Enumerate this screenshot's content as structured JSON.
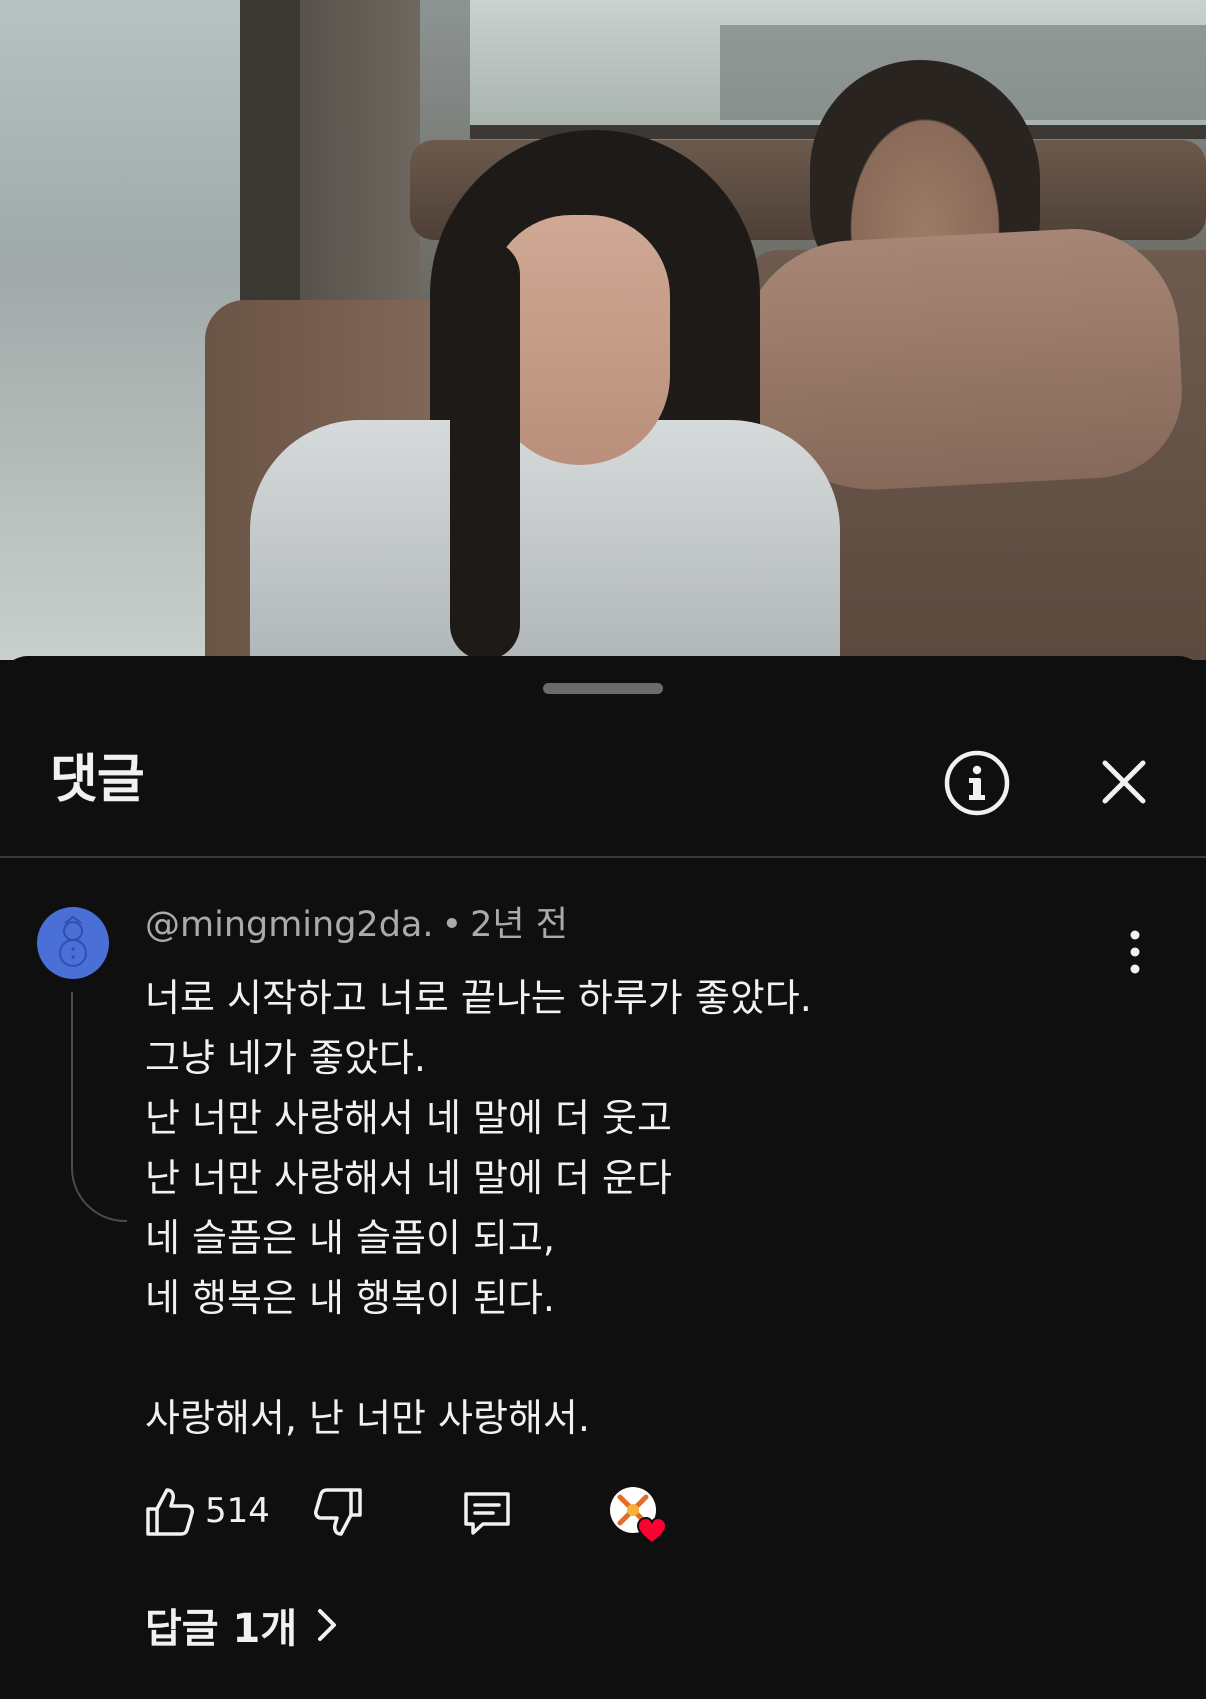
{
  "sheet": {
    "title": "댓글",
    "info_icon": "info-circle-icon",
    "close_icon": "close-icon"
  },
  "comment": {
    "author": "@mingming2da.",
    "separator": "•",
    "time": "2년 전",
    "avatar_color": "#4a6fd6",
    "lines": [
      "너로 시작하고 너로 끝나는 하루가 좋았다.",
      "그냥 네가 좋았다.",
      "난 너만 사랑해서 네 말에 더 웃고",
      "난 너만 사랑해서 네 말에 더 운다",
      "네 슬픔은 내 슬픔이 되고,",
      "네 행복은 내 행복이 된다.",
      "",
      "사랑해서, 난 너만 사랑해서."
    ],
    "likes": "514",
    "replies_label": "답글 1개",
    "heart_color": "#ff0033"
  }
}
